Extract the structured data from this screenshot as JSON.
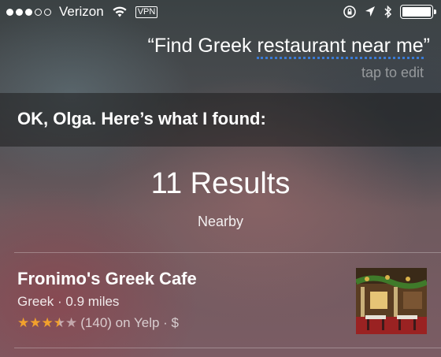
{
  "status_bar": {
    "carrier": "Verizon",
    "vpn": "VPN",
    "signal_bars_filled": 3,
    "signal_bars_total": 5,
    "battery_level": 1.0,
    "icons": [
      "wifi-icon",
      "orientation-lock-icon",
      "location-arrow-icon",
      "bluetooth-icon",
      "battery-icon"
    ]
  },
  "query": {
    "open_quote": "“",
    "plain": "Find Greek ",
    "underlined": "restaurant near me",
    "close_quote": "”",
    "tap_to_edit": "tap to edit"
  },
  "response": {
    "text": "OK, Olga. Here’s what I found:"
  },
  "results": {
    "count_label": "11 Results",
    "subtitle": "Nearby"
  },
  "result_card": {
    "name": "Fronimo's Greek Cafe",
    "meta": "Greek · 0.9 miles",
    "rating": 3.5,
    "rating_text": "(140) on Yelp · $",
    "accent": "#f2a12c"
  }
}
